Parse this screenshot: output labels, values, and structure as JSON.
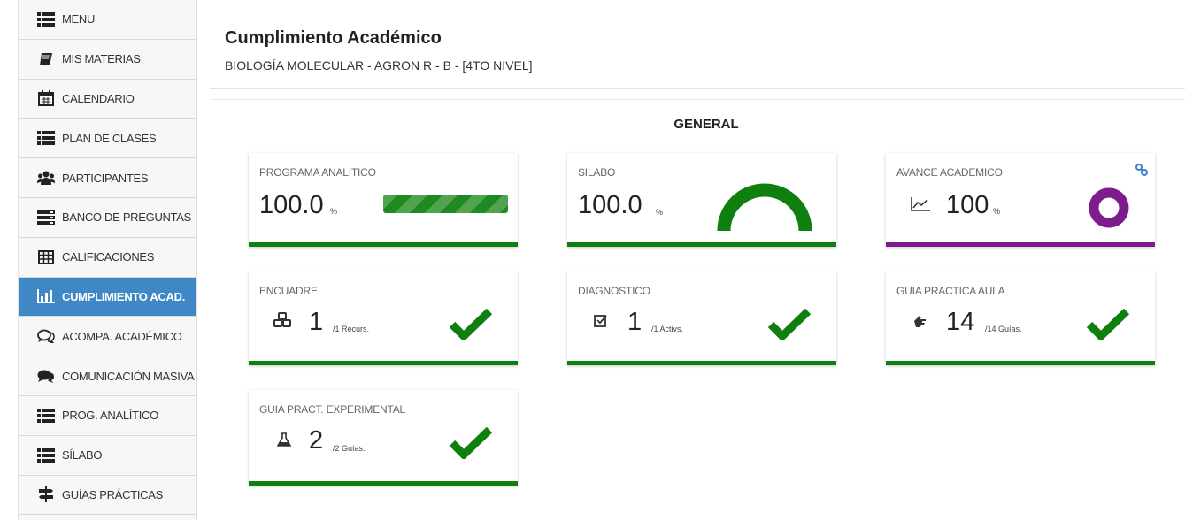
{
  "sidebar": {
    "items": [
      {
        "label": "MENU",
        "icon": "list-icon"
      },
      {
        "label": "MIS MATERIAS",
        "icon": "book-icon"
      },
      {
        "label": "CALENDARIO",
        "icon": "calendar-icon"
      },
      {
        "label": "PLAN DE CLASES",
        "icon": "list-icon"
      },
      {
        "label": "PARTICIPANTES",
        "icon": "users-icon"
      },
      {
        "label": "BANCO DE PREGUNTAS",
        "icon": "server-icon"
      },
      {
        "label": "CALIFICACIONES",
        "icon": "table-icon"
      },
      {
        "label": "CUMPLIMIENTO ACAD.",
        "icon": "bar-chart-icon",
        "active": true
      },
      {
        "label": "ACOMPA. ACADÉMICO",
        "icon": "comments-icon"
      },
      {
        "label": "COMUNICACIÓN MASIVA",
        "icon": "comments-solid-icon"
      },
      {
        "label": "PROG. ANALÍTICO",
        "icon": "list-icon"
      },
      {
        "label": "SÍLABO",
        "icon": "list-icon"
      },
      {
        "label": "GUÍAS PRÁCTICAS",
        "icon": "signpost-icon"
      }
    ]
  },
  "header": {
    "title": "Cumplimiento Académico",
    "subtitle": "BIOLOGÍA MOLECULAR - AGRON R - B - [4TO NIVEL]"
  },
  "main": {
    "section_title": "GENERAL",
    "cards": {
      "programa": {
        "label": "PROGRAMA ANALITICO",
        "value": "100.0",
        "unit": "%",
        "progress": 1.0
      },
      "silabo": {
        "label": "SILABO",
        "value": "100.0",
        "unit": "%",
        "gauge": 1.0
      },
      "avance": {
        "label": "AVANCE ACADEMICO",
        "value": "100",
        "unit": "%",
        "ring": 1.0
      },
      "encuadre": {
        "label": "ENCUADRE",
        "value": "1",
        "detail": "/1 Recurs.",
        "icon": "cubes-icon",
        "status": "check-icon"
      },
      "diagnostico": {
        "label": "DIAGNOSTICO",
        "value": "1",
        "detail": "/1 Activs.",
        "icon": "checkbox-icon",
        "status": "check-icon"
      },
      "guia_aula": {
        "label": "GUIA PRACTICA AULA",
        "value": "14",
        "detail": "/14 Guías.",
        "icon": "hand-icon",
        "status": "check-icon"
      },
      "guia_exp": {
        "label": "GUIA PRACT. EXPERIMENTAL",
        "value": "2",
        "detail": "/2 Guías.",
        "icon": "flask-icon",
        "status": "check-icon"
      }
    }
  },
  "colors": {
    "active_nav": "#3f88c5",
    "green": "#0f7f0f",
    "purple": "#7d1b8f",
    "link_blue": "#3a7fd0"
  }
}
